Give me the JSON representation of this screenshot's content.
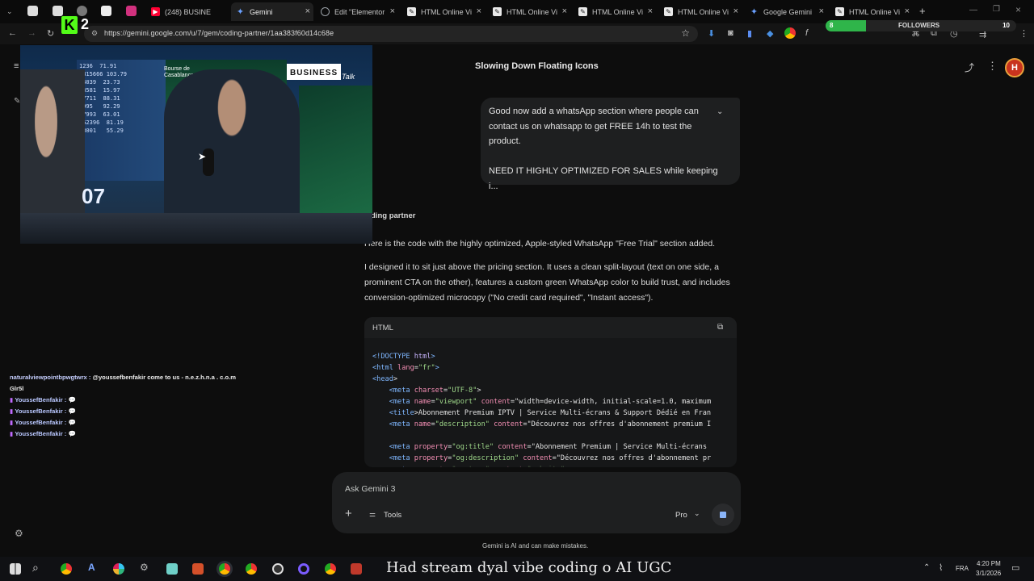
{
  "browser": {
    "tabs": [
      {
        "label": "(248) BUSINE",
        "favicon": "youtube-icon",
        "color": "#ff0033"
      },
      {
        "label": "Gemini",
        "favicon": "gemini-icon",
        "color": "#6aa0ff"
      },
      {
        "label": "Edit \"Elementor",
        "favicon": "globe-icon",
        "color": "#9aa0a6"
      },
      {
        "label": "HTML Online Vi",
        "favicon": "document-icon",
        "color": "#e9e9e9"
      },
      {
        "label": "HTML Online Vi",
        "favicon": "document-icon",
        "color": "#e9e9e9"
      },
      {
        "label": "HTML Online Vi",
        "favicon": "document-icon",
        "color": "#e9e9e9"
      },
      {
        "label": "HTML Online Vi",
        "favicon": "document-icon",
        "color": "#e9e9e9"
      },
      {
        "label": "Google Gemini",
        "favicon": "gemini-icon",
        "color": "#6aa0ff"
      },
      {
        "label": "HTML Online Vi",
        "favicon": "document-icon",
        "color": "#e9e9e9"
      }
    ],
    "url": "https://gemini.google.com/u/7/gem/coding-partner/1aa383f60d14c68e",
    "kick_badge": "2",
    "followers_label": "FOLLOWERS",
    "followers_left": "8",
    "followers_right": "10"
  },
  "conversation": {
    "title": "Slowing Down Floating Icons",
    "user_prompt_line1": "Good now add a whatsApp section where people can contact us on whatsapp to get FREE 14h to test the product.",
    "user_prompt_line2": "NEED IT HIGHLY OPTIMIZED FOR SALES while keeping i...",
    "assistant_role": "ding partner",
    "response_p1": "Here is the code with the highly optimized, Apple-styled WhatsApp \"Free Trial\" section added.",
    "response_p2": "I designed it to sit just above the pricing section. It uses a clean split-layout (text on one side, a prominent CTA on the other), features a custom green WhatsApp color to build trust, and includes conversion-optimized microcopy (\"No credit card required\", \"Instant access\").",
    "code_lang": "HTML",
    "code_lines": [
      [
        "t",
        "<!DOCTYPE "
      ],
      [
        "t",
        "<html "
      ],
      [
        "t",
        "<head>"
      ],
      [
        "x",
        "<meta charset=\"UTF-8\">"
      ],
      [
        "x",
        "<meta name=\"viewport\" content=\"width=device-width, initial-scale=1.0, maximum"
      ],
      [
        "x",
        "<title>Abonnement Premium IPTV | Service Multi-écrans & Support Dédié en Fran"
      ],
      [
        "x",
        "<meta name=\"description\" content=\"Découvrez nos offres d'abonnement premium I"
      ],
      [
        "x",
        ""
      ],
      [
        "x",
        "<meta property=\"og:title\" content=\"Abonnement Premium | Service Multi-écrans"
      ],
      [
        "x",
        "<meta property=\"og:description\" content=\"Découvrez nos offres d'abonnement pr"
      ],
      [
        "x",
        "<meta property=\"og:type\" content=\"website\">"
      ]
    ],
    "composer_placeholder": "Ask Gemini 3",
    "tools_label": "Tools",
    "mode_label": "Pro",
    "disclaimer": "Gemini is AI and can make mistakes."
  },
  "stream": {
    "video_banner": "BUSINESS",
    "video_banner_tag": "Talk",
    "video_board_sign": "Bourse de Casablance",
    "video_big_number": "07",
    "chat": [
      {
        "user": "naturalviewpointbpwgtwrx :",
        "msg": "@youssefbenfakir come to us - n.e.z.h.n.a . c.o.m Glr5l"
      },
      {
        "user": "YoussefBenfakir :",
        "msg": "💬"
      },
      {
        "user": "YoussefBenfakir :",
        "msg": "💬"
      },
      {
        "user": "YoussefBenfakir :",
        "msg": "💬"
      },
      {
        "user": "YoussefBenfakir :",
        "msg": "💬"
      }
    ],
    "caption": "Had stream dyal vibe coding o AI UGC"
  },
  "taskbar": {
    "lang": "FRA",
    "time": "4:20 PM",
    "date": "3/1/2026"
  },
  "colors": {
    "whatsapp_green": "#1fd655",
    "kick_green": "#53fc18",
    "accent_blue": "#8ab4f8"
  }
}
